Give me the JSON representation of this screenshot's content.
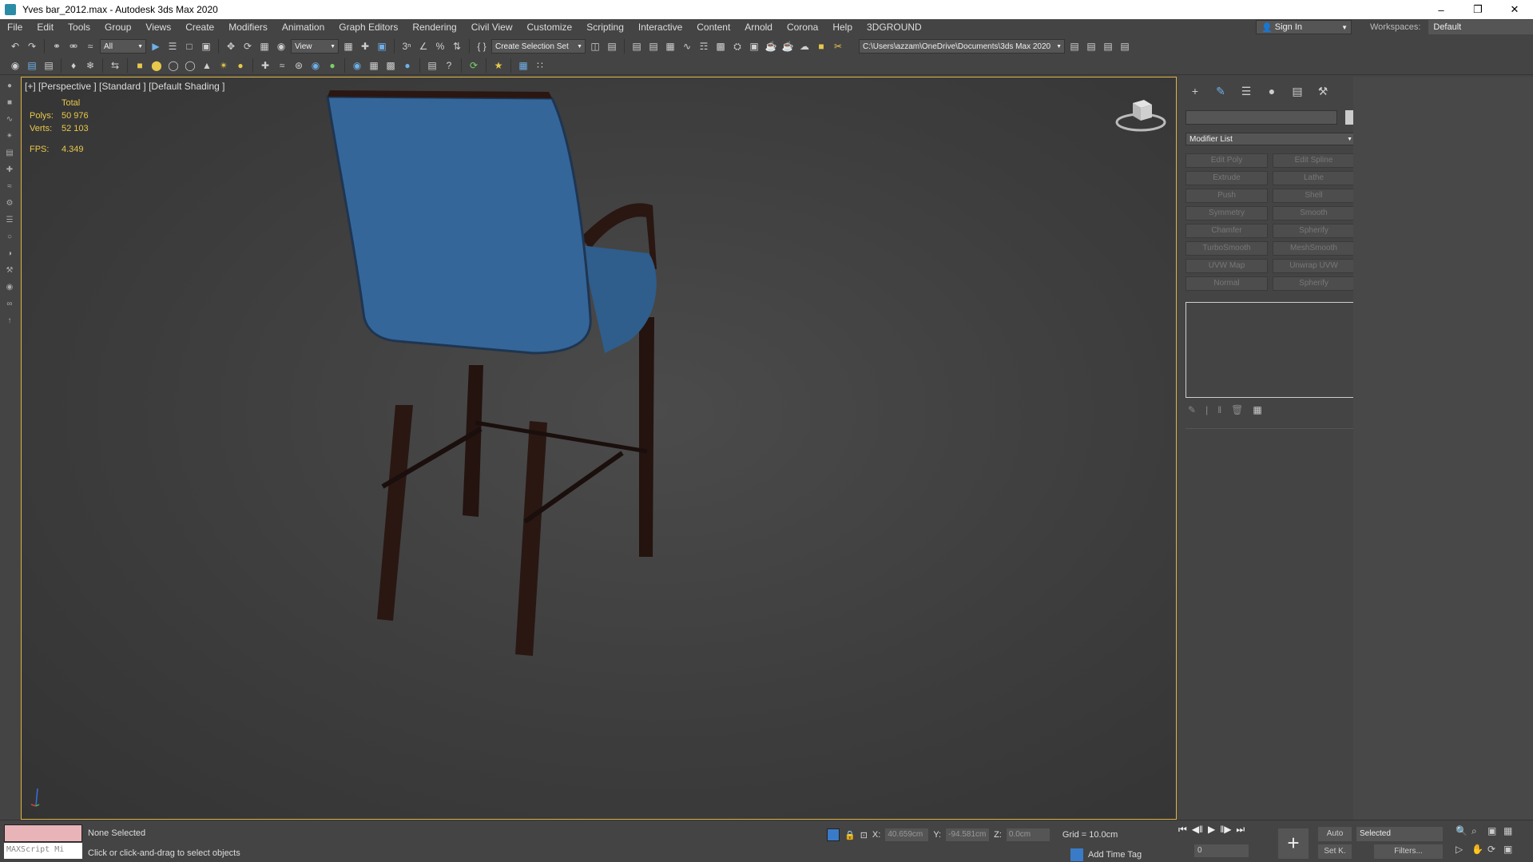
{
  "window": {
    "title": "Yves bar_2012.max - Autodesk 3ds Max 2020",
    "controls": [
      "–",
      "❐",
      "✕"
    ]
  },
  "menu": [
    "File",
    "Edit",
    "Tools",
    "Group",
    "Views",
    "Create",
    "Modifiers",
    "Animation",
    "Graph Editors",
    "Rendering",
    "Civil View",
    "Customize",
    "Scripting",
    "Interactive",
    "Content",
    "Arnold",
    "Corona",
    "Help",
    "3DGROUND"
  ],
  "account": {
    "sign_in": "Sign In"
  },
  "workspaces": {
    "label": "Workspaces:",
    "value": "Default"
  },
  "toolbar": {
    "selection_filter": "All",
    "ref_coord": "View",
    "selection_set": "Create Selection Set",
    "project_path": "C:\\Users\\azzam\\OneDrive\\Documents\\3ds Max 2020"
  },
  "viewport": {
    "label": "[+] [Perspective ] [Standard ] [Default Shading ]",
    "stats": {
      "total_label": "Total",
      "polys_label": "Polys:",
      "polys_value": "50 976",
      "verts_label": "Verts:",
      "verts_value": "52 103",
      "fps_label": "FPS:",
      "fps_value": "4.349"
    },
    "colors": {
      "seat_fabric": "#2f5d8c",
      "wood": "#2a1712",
      "border": "#e0b442"
    }
  },
  "command_panel": {
    "modifier_list": "Modifier List",
    "modifiers": [
      "Edit Poly",
      "Edit Spline",
      "Extrude",
      "Lathe",
      "Push",
      "Shell",
      "Symmetry",
      "Smooth",
      "Chamfer",
      "Spherify",
      "TurboSmooth",
      "MeshSmooth",
      "UVW Map",
      "Unwrap UVW",
      "Normal",
      "Spherify"
    ]
  },
  "status": {
    "maxscript": "MAXScript Mi",
    "selection": "None Selected",
    "prompt": "Click or click-and-drag to select objects",
    "x_label": "X:",
    "x_value": "40.659cm",
    "y_label": "Y:",
    "y_value": "-94.581cm",
    "z_label": "Z:",
    "z_value": "0.0cm",
    "grid": "Grid = 10.0cm",
    "add_time_tag": "Add Time Tag",
    "frame": "0",
    "auto": "Auto",
    "set_key": "Set K.",
    "key_filter": "Selected",
    "filters": "Filters..."
  }
}
